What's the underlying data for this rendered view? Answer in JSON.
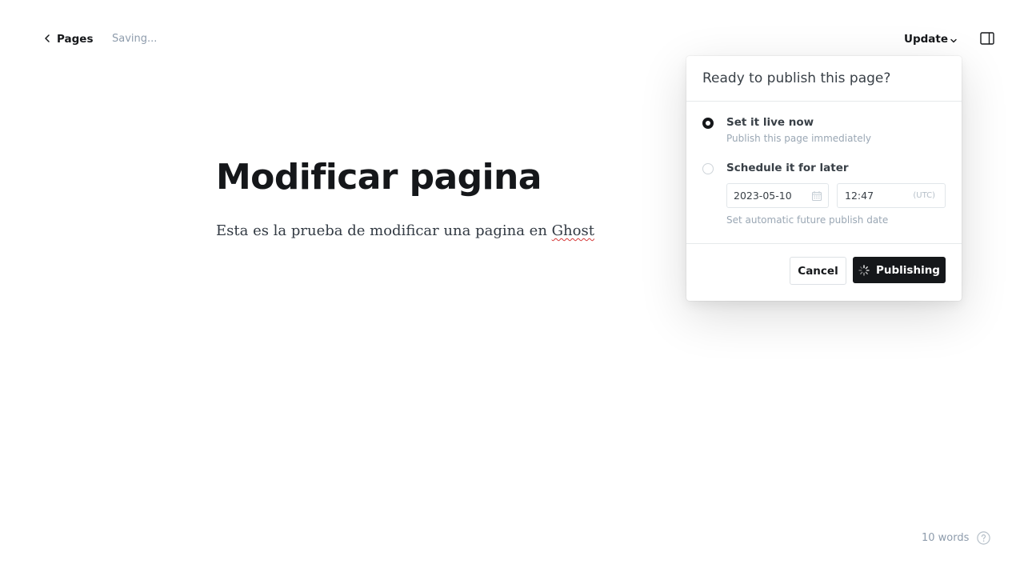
{
  "header": {
    "back_label": "Pages",
    "status_text": "Saving...",
    "update_label": "Update",
    "icons": {
      "back": "chevron-left-icon",
      "update_caret": "chevron-down-icon",
      "sidebar": "sidebar-toggle-icon"
    }
  },
  "editor": {
    "title": "Modificar pagina",
    "body_before": "Esta es la prueba de modificar una pagina en ",
    "body_flagged_word": "Ghost"
  },
  "publish_menu": {
    "heading": "Ready to publish this page?",
    "options": [
      {
        "label": "Set it live now",
        "description": "Publish this page immediately",
        "selected": true
      },
      {
        "label": "Schedule it for later",
        "description": "",
        "selected": false
      }
    ],
    "schedule": {
      "date": "2023-05-10",
      "time": "12:47",
      "timezone": "(UTC)",
      "note": "Set automatic future publish date"
    },
    "cancel_label": "Cancel",
    "publish_label": "Publishing"
  },
  "footer": {
    "word_count": "10 words",
    "help_icon": "question-circle-icon"
  },
  "colors": {
    "primary_button": "#15171a",
    "muted_text": "#9aa7b4",
    "spellcheck_underline": "#d63939"
  }
}
